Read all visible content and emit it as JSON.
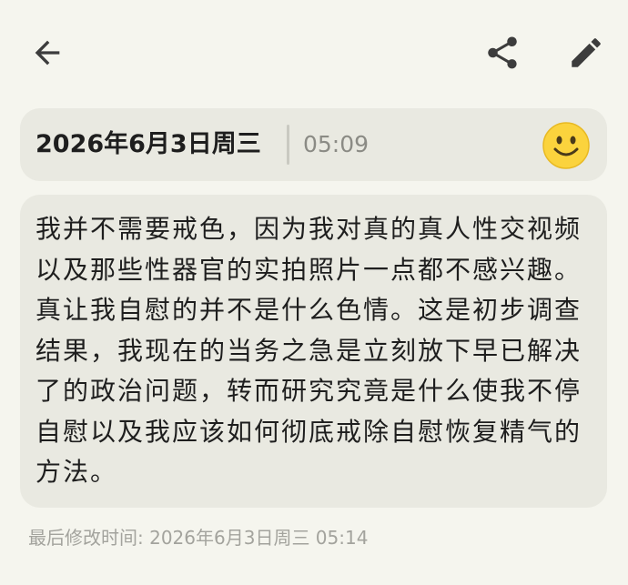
{
  "toolbar": {
    "back_icon": "arrow-left-icon",
    "share_icon": "share-icon",
    "edit_icon": "pencil-icon"
  },
  "entry": {
    "date": "2026年6月3日周三",
    "time": "05:09",
    "mood_icon": "smiley-face-icon",
    "content": "我并不需要戒色，因为我对真的真人性交视频以及那些性器官的实拍照片一点都不感兴趣。真让我自慰的并不是什么色情。这是初步调查结果，我现在的当务之急是立刻放下早已解决了的政治问题，转而研究究竟是什么使我不停自慰以及我应该如何彻底戒除自慰恢复精气的方法。",
    "last_modified": "最后修改时间: 2026年6月3日周三 05:14"
  },
  "colors": {
    "background": "#f5f5ee",
    "card": "#e9e9e1",
    "icon": "#3c3c3c",
    "text": "#1e1e1e",
    "muted": "#8b8b85",
    "emoji_face": "#fbd33d"
  }
}
